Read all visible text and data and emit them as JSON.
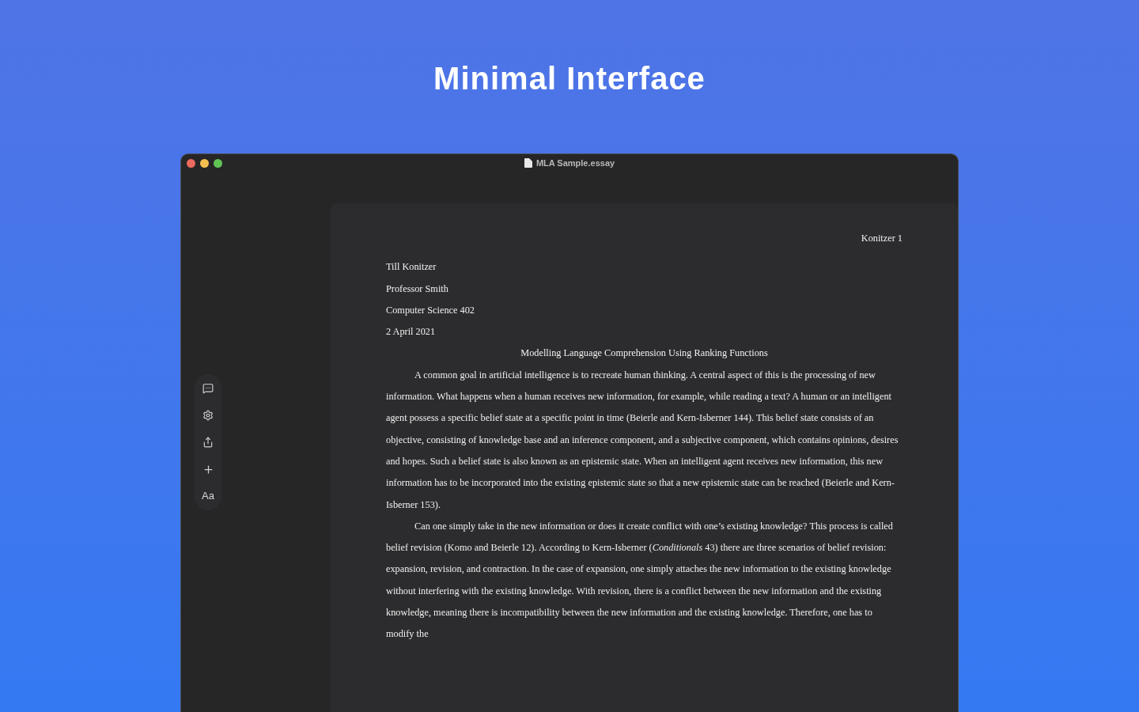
{
  "headline": "Minimal Interface",
  "window": {
    "title": "MLA Sample.essay"
  },
  "toolbar": [
    {
      "kind": "comment"
    },
    {
      "kind": "settings"
    },
    {
      "kind": "share"
    },
    {
      "kind": "add"
    },
    {
      "kind": "font",
      "label": "Aa"
    }
  ],
  "document": {
    "page_header": "Konitzer 1",
    "heading_lines": [
      "Till Konitzer",
      "Professor Smith",
      "Computer Science 402",
      "2 April 2021"
    ],
    "title": "Modelling Language Comprehension Using Ranking Functions",
    "paragraphs": [
      "A common goal in artificial intelligence is to recreate human thinking. A central aspect of this is the processing of new information. What happens when a human receives new information, for example, while reading a text? A human or an intelligent agent possess a specific belief state at a specific point in time (Beierle and Kern-Isberner 144). This belief state consists of an objective, consisting of knowledge base and an inference component, and a subjective component, which contains opinions, desires and hopes. Such a belief state is also known as an epistemic state. When an intelligent agent receives new information, this new information has to be incorporated into the existing epistemic state so that a new epistemic state can be reached (Beierle and Kern-Isberner 153).",
      "Can one simply take in the new information or does it create conflict with one’s existing knowledge? This process is called belief revision (Komo and Beierle 12). According to Kern-Isberner (*Conditionals* 43) there are three scenarios of belief revision: expansion, revision, and contraction. In the case of expansion, one simply attaches the new information to the existing knowledge without interfering with the existing knowledge. With revision, there is a conflict between the new information and the existing knowledge, meaning there is incompatibility between the new information and the existing knowledge. Therefore, one has to modify the"
    ]
  }
}
